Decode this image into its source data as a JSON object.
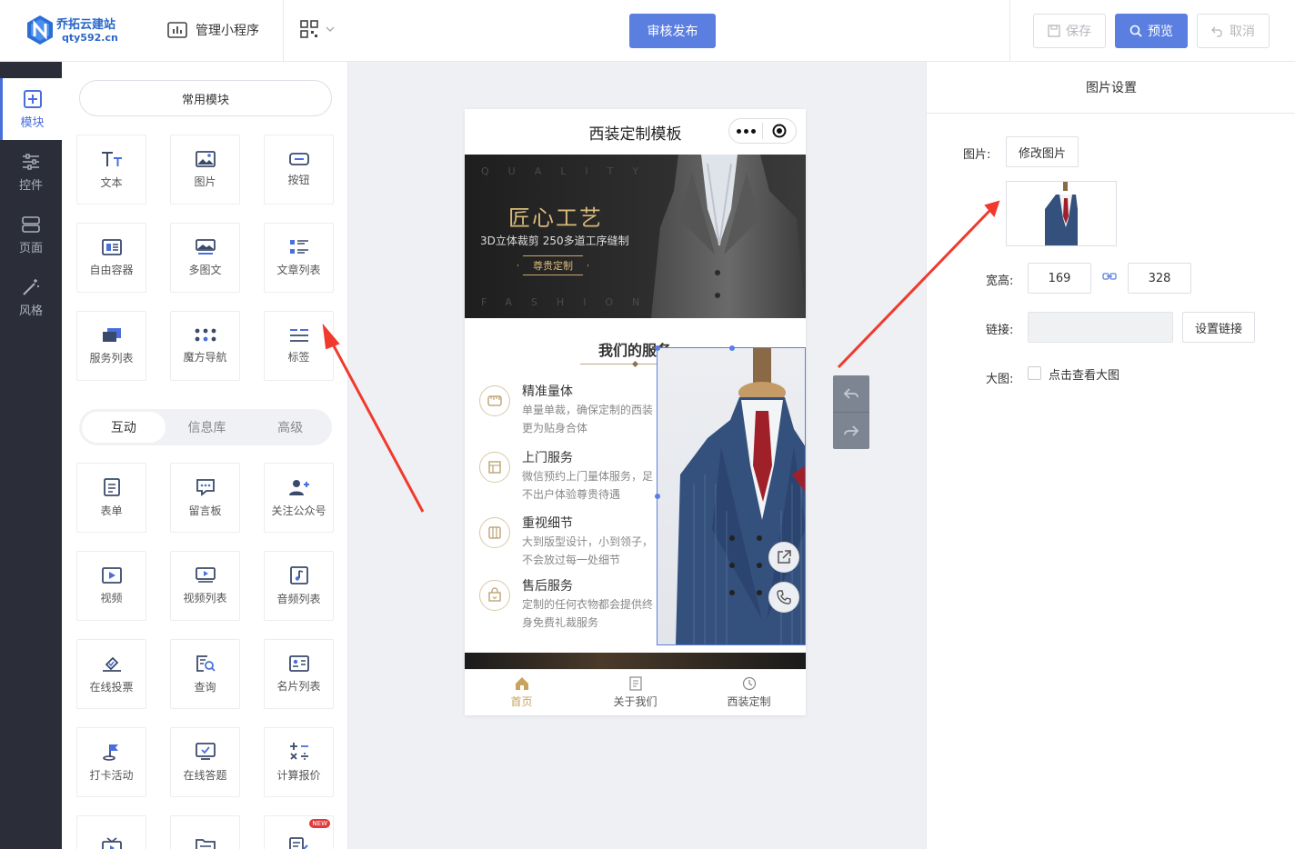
{
  "header": {
    "logo_title": "乔拓云建站",
    "logo_domain": "qty592.cn",
    "manage_label": "管理小程序",
    "publish_label": "审核发布",
    "save_label": "保存",
    "preview_label": "预览",
    "cancel_label": "取消"
  },
  "sidebar": {
    "items": [
      {
        "label": "模块",
        "icon": "plus-square-icon"
      },
      {
        "label": "控件",
        "icon": "sliders-icon"
      },
      {
        "label": "页面",
        "icon": "page-layers-icon"
      },
      {
        "label": "风格",
        "icon": "magic-wand-icon"
      }
    ]
  },
  "modules": {
    "common_label": "常用模块",
    "common": [
      "文本",
      "图片",
      "按钮",
      "自由容器",
      "多图文",
      "文章列表",
      "服务列表",
      "魔方导航",
      "标签"
    ],
    "tabs": [
      "互动",
      "信息库",
      "高级"
    ],
    "interactive": [
      "表单",
      "留言板",
      "关注公众号",
      "视频",
      "视频列表",
      "音频列表",
      "在线投票",
      "查询",
      "名片列表",
      "打卡活动",
      "在线答题",
      "计算报价"
    ],
    "new_badge": "NEW"
  },
  "phone": {
    "title": "西装定制模板",
    "banner": {
      "quality_text": "QUALITY",
      "fashion_text": "FASHION",
      "headline": "匠心工艺",
      "subline": "3D立体裁剪  250多道工序缝制",
      "button": "尊贵定制"
    },
    "services": {
      "title": "我们的服务",
      "items": [
        {
          "name": "精准量体",
          "desc": "单量单裁，确保定制的西装更为贴身合体"
        },
        {
          "name": "上门服务",
          "desc": "微信预约上门量体服务，足不出户体验尊贵待遇"
        },
        {
          "name": "重视细节",
          "desc": "大到版型设计，小到领子，不会放过每一处细节"
        },
        {
          "name": "售后服务",
          "desc": "定制的任何衣物都会提供终身免费礼裁服务"
        }
      ]
    },
    "tabbar": [
      "首页",
      "关于我们",
      "西装定制"
    ]
  },
  "settings": {
    "title": "图片设置",
    "image_label": "图片:",
    "change_image": "修改图片",
    "size_label": "宽高:",
    "width": "169",
    "height": "328",
    "link_label": "链接:",
    "set_link": "设置链接",
    "large_label": "大图:",
    "large_checkbox": "点击查看大图"
  },
  "colors": {
    "accent": "#5b7fe0",
    "sidebar_bg": "#2b2e38",
    "gold": "#c9a25c",
    "arrow": "#f03a2e"
  }
}
